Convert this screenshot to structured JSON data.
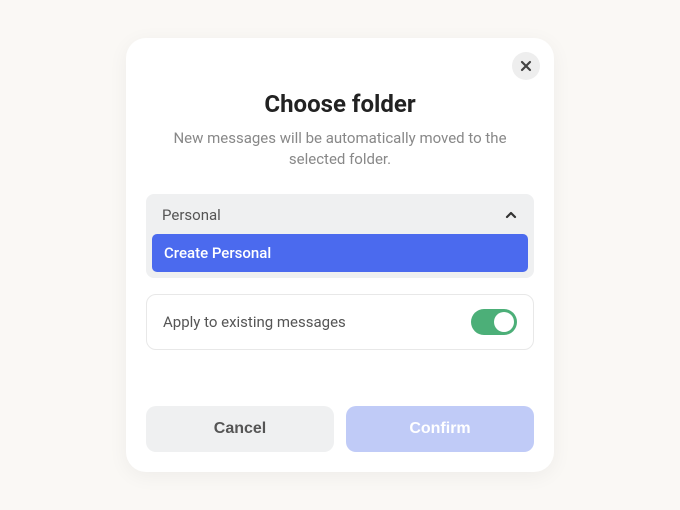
{
  "modal": {
    "title": "Choose folder",
    "subtitle": "New messages will be automatically moved to the selected folder.",
    "folder_select": {
      "value": "Personal",
      "option": "Create Personal"
    },
    "toggle": {
      "label": "Apply to existing messages",
      "on": true
    },
    "buttons": {
      "cancel": "Cancel",
      "confirm": "Confirm"
    }
  }
}
